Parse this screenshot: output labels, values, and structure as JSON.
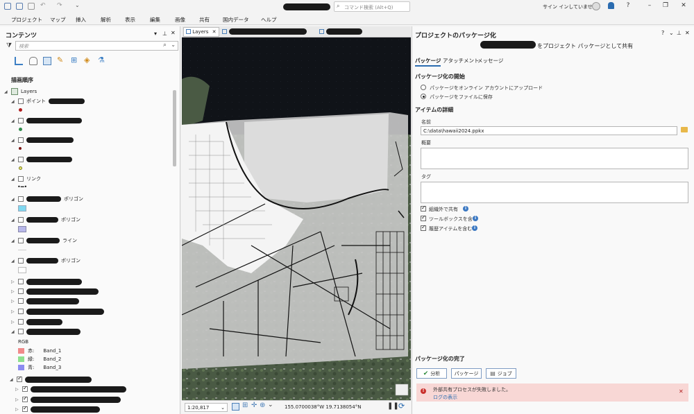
{
  "titlebar": {
    "command_search_placeholder": "コマンド検索 (Alt+Q)",
    "signin_text": "サイン インしていません",
    "help_glyph": "?"
  },
  "ribbon": {
    "tabs": [
      "プロジェクト",
      "マップ",
      "挿入",
      "解析",
      "表示",
      "編集",
      "画像",
      "共有",
      "国内データ",
      "ヘルプ"
    ]
  },
  "contents": {
    "title": "コンテンツ",
    "search_placeholder": "検索",
    "section_label": "描画順序",
    "root_layer": "Layers",
    "layers": [
      {
        "label": "ポイント",
        "redact": 52
      },
      {
        "label": "",
        "redact": 80
      },
      {
        "label": "",
        "redact": 68
      },
      {
        "label": "",
        "redact": 66
      },
      {
        "label": "リンク",
        "redact": 0
      },
      {
        "label": "ポリゴン",
        "redact": 50
      },
      {
        "label": "ポリゴン",
        "redact": 46
      },
      {
        "label": "ライン",
        "redact": 48
      },
      {
        "label": "ポリゴン",
        "redact": 46
      }
    ],
    "rgb_label": "RGB",
    "bands": [
      {
        "channel": "赤:",
        "band": "Band_1",
        "color": "#f08a8a"
      },
      {
        "channel": "緑:",
        "band": "Band_2",
        "color": "#8ee08e"
      },
      {
        "channel": "青:",
        "band": "Band_3",
        "color": "#8c8cf0"
      }
    ]
  },
  "map": {
    "tab_label": "Layers",
    "scale": "1:20,817",
    "coordinates": "155.0700038°W 19.7138054°N"
  },
  "package": {
    "pane_title": "プロジェクトのパッケージ化",
    "share_heading_suffix": "をプロジェクト パッケージとして共有",
    "subtabs": [
      "パッケージ",
      "アタッチメント",
      "メッセージ"
    ],
    "start_heading": "パッケージ化の開始",
    "option_upload": "パッケージをオンライン アカウントにアップロード",
    "option_save": "パッケージをファイルに保存",
    "item_heading": "アイテムの詳細",
    "name_label": "名前",
    "name_value": "C:\\data\\hawaii2024.ppkx",
    "summary_label": "概要",
    "tags_label": "タグ",
    "check_share_outside": "組織外で共有",
    "check_toolbox": "ツールボックスを含む",
    "check_history": "履歴アイテムを含む",
    "finish_heading": "パッケージ化の完了",
    "btn_analyze": "分析",
    "btn_package": "パッケージ",
    "btn_jobs": "ジョブ",
    "error_message": "外部共有プロセスが失敗しました。",
    "error_link": "ログの表示"
  }
}
